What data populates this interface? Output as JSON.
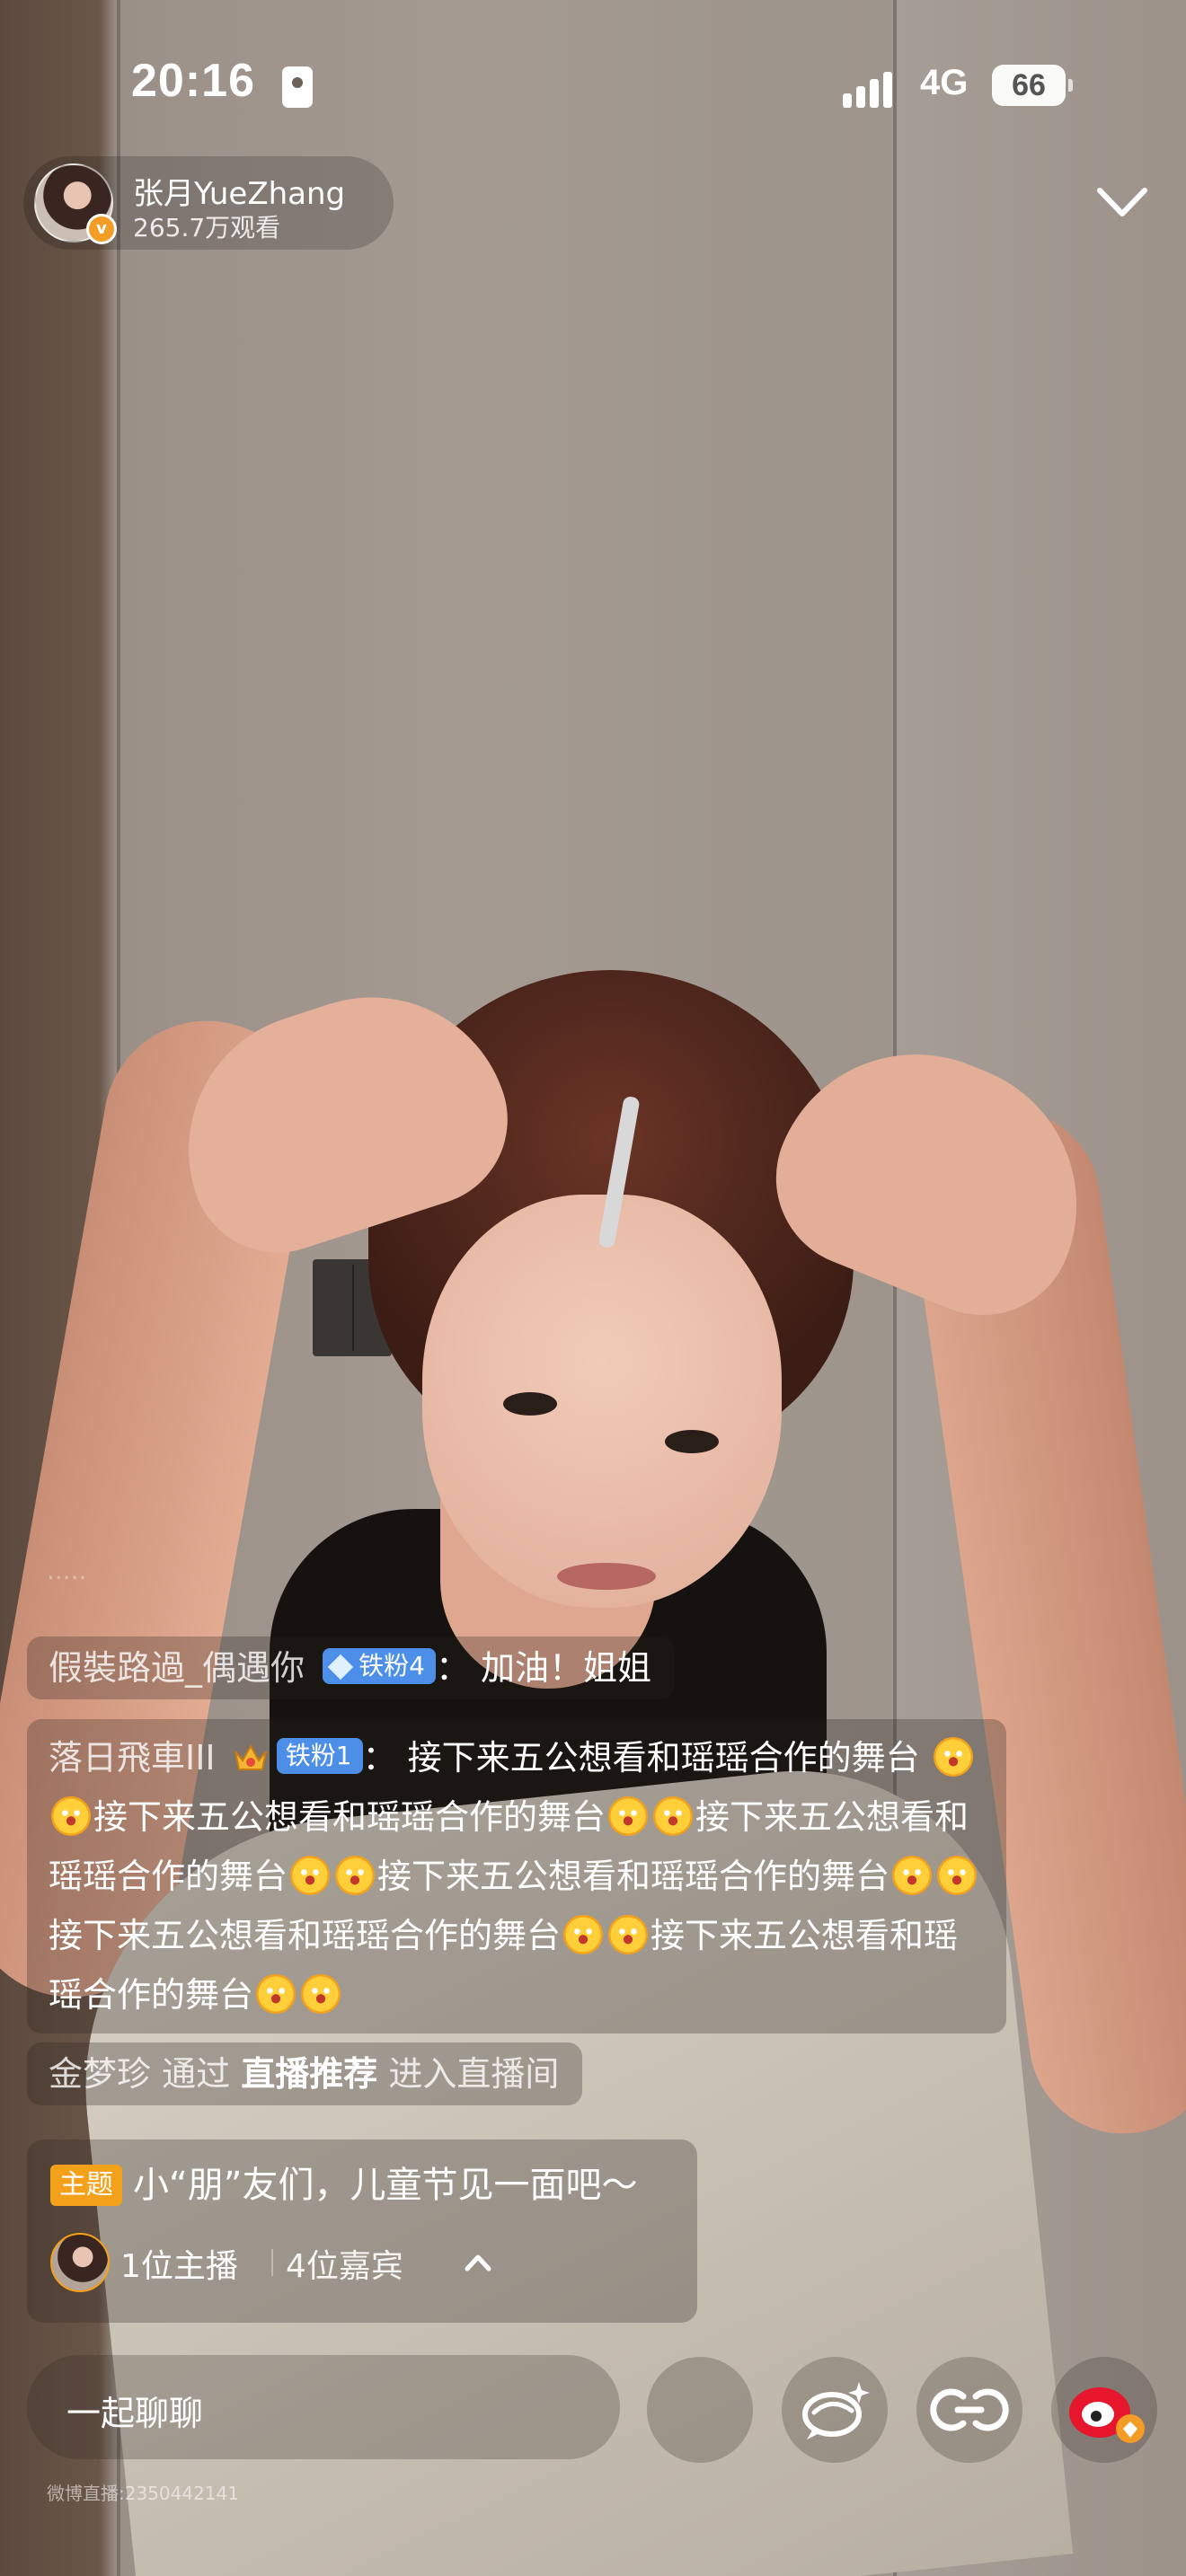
{
  "status_bar": {
    "time": "20:16",
    "network": "4G",
    "battery": "66"
  },
  "host": {
    "name": "张月YueZhang",
    "views": "265.7万观看"
  },
  "comments": [
    {
      "user": "假裝路過_偶遇你",
      "badge": "铁粉4",
      "separator": "：",
      "text": "加油！姐姐"
    },
    {
      "user": "落日飛車III",
      "badge": "铁粉1",
      "separator": "：",
      "segments": [
        "接下来五公想看和瑶瑶合作的舞台",
        "接下来五公想看和瑶瑶合作的舞台",
        "接下来五公想看和瑶瑶合作的舞台",
        "接下来五公想看和瑶瑶合作的舞台",
        "接下来五公想看和瑶瑶合作的舞台",
        "接下来五公想看和瑶瑶合作的舞台"
      ]
    }
  ],
  "entry_notice": {
    "user": "金梦珍",
    "via": "通过",
    "source": "直播推荐",
    "action": "进入直播间"
  },
  "topic": {
    "tag": "主题",
    "text": "小“朋”友们，儿童节见一面吧～",
    "hosts": "1位主播",
    "guests": "4位嘉宾"
  },
  "bottom_bar": {
    "chat_label": "一起聊聊"
  },
  "watermark": "微博直播:2350442141",
  "icons": {
    "collapse": "chevron-down-icon",
    "chat_bubble": "sparkle-chat-icon",
    "link": "link-icon",
    "weibo": "weibo-logo-icon"
  },
  "colors": {
    "topic_tag": "#f3a01b",
    "fan_badge": "#4d8fe8",
    "weibo_red": "#e6162d"
  }
}
